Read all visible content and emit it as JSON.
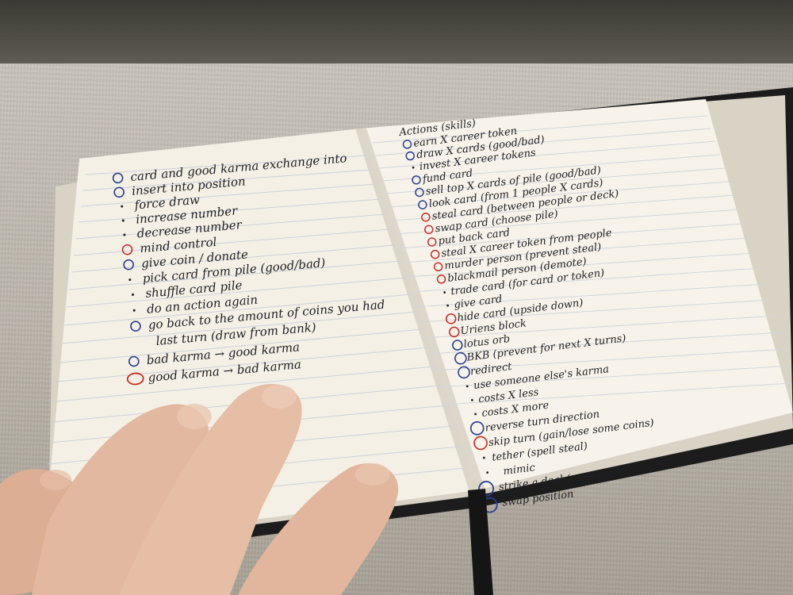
{
  "notebook": {
    "left_page": {
      "lines": [
        {
          "text": "card and good karma exchange into",
          "marker": "blue"
        },
        {
          "text": "insert into position",
          "marker": "blue"
        },
        {
          "text": "force draw",
          "marker": "dot"
        },
        {
          "text": "increase number",
          "marker": "dot"
        },
        {
          "text": "decrease number",
          "marker": "dot"
        },
        {
          "text": "mind control",
          "marker": "red"
        },
        {
          "text": "give coin / donate",
          "marker": "blue"
        },
        {
          "text": "pick card from pile (good/bad)",
          "marker": "dot"
        },
        {
          "text": "shuffle card pile",
          "marker": "dot"
        },
        {
          "text": "do an action again",
          "marker": "dot"
        },
        {
          "text": "go back to the amount of coins you had",
          "marker": "blue"
        },
        {
          "text": "last turn (draw from bank)",
          "marker": "none"
        },
        {
          "text": "bad karma → good karma",
          "marker": "blue"
        },
        {
          "text": "good karma → bad karma",
          "marker": "red"
        }
      ]
    },
    "right_page": {
      "heading": "Actions (skills)",
      "lines": [
        {
          "text": "earn X career token",
          "marker": "blue"
        },
        {
          "text": "draw X cards (good/bad)",
          "marker": "blue"
        },
        {
          "text": "invest X career tokens",
          "marker": "dot"
        },
        {
          "text": "fund card",
          "marker": "blue"
        },
        {
          "text": "sell top X cards of pile (good/bad)",
          "marker": "blue"
        },
        {
          "text": "look card (from 1 people X cards)",
          "marker": "blue"
        },
        {
          "text": "steal card (between people or deck)",
          "marker": "red"
        },
        {
          "text": "swap card (choose pile)",
          "marker": "red"
        },
        {
          "text": "put back card",
          "marker": "red"
        },
        {
          "text": "steal X career token from people",
          "marker": "red"
        },
        {
          "text": "murder person (prevent steal)",
          "marker": "red"
        },
        {
          "text": "blackmail person (demote)",
          "marker": "red"
        },
        {
          "text": "trade card (for card or token)",
          "marker": "dot"
        },
        {
          "text": "give card",
          "marker": "dot"
        },
        {
          "text": "hide card (upside down)",
          "marker": "red"
        },
        {
          "text": "Uriens block",
          "marker": "red"
        },
        {
          "text": "lotus orb",
          "marker": "blue"
        },
        {
          "text": "BKB (prevent for next X turns)",
          "marker": "blue"
        },
        {
          "text": "redirect",
          "marker": "blue"
        },
        {
          "text": "use someone else's karma",
          "marker": "dot"
        },
        {
          "text": "costs X less",
          "marker": "dot"
        },
        {
          "text": "costs X more",
          "marker": "dot"
        },
        {
          "text": "reverse turn direction",
          "marker": "blue"
        },
        {
          "text": "skip turn (gain/lose some coins)",
          "marker": "red"
        },
        {
          "text": "tether (spell steal)",
          "marker": "dot"
        },
        {
          "text": "mimic",
          "marker": "dot"
        },
        {
          "text": "strike a deal (or penalty)",
          "marker": "blue"
        },
        {
          "text": "swap position",
          "marker": "blue"
        }
      ]
    }
  },
  "colors": {
    "ink_black": "#1f1f24",
    "ink_blue": "#2a3f8f",
    "ink_red": "#c8302a",
    "page": "#f4f0e6",
    "cover": "#1a1a1a",
    "ribbon": "#151515",
    "skin": "#e3b8a0"
  }
}
